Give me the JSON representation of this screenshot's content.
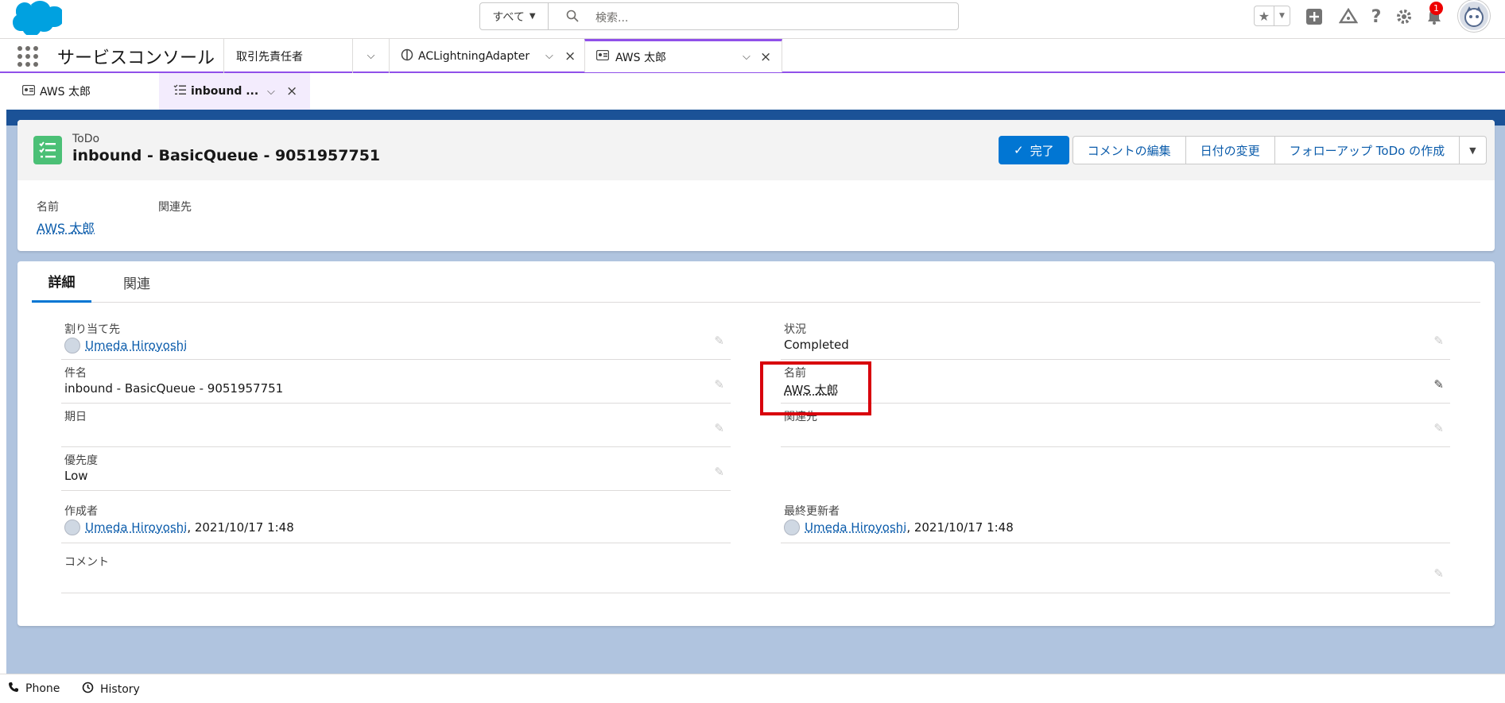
{
  "header": {
    "search_scope": "すべて",
    "search_placeholder": "検索...",
    "notification_count": "1"
  },
  "nav": {
    "app_name": "サービスコンソール",
    "tabs": [
      {
        "label": "取引先責任者"
      },
      {
        "label": "ACLightningAdapter"
      },
      {
        "label": "AWS 太郎"
      }
    ]
  },
  "subtabs": [
    {
      "label": "AWS 太郎"
    },
    {
      "label": "inbound ..."
    }
  ],
  "record": {
    "object_type": "ToDo",
    "title": "inbound - BasicQueue - 9051957751",
    "buttons": {
      "complete": "完了",
      "edit_comment": "コメントの編集",
      "change_date": "日付の変更",
      "create_followup": "フォローアップ ToDo の作成"
    },
    "highlights": {
      "name_label": "名前",
      "name_value": "AWS 太郎",
      "related_label": "関連先"
    }
  },
  "detail": {
    "tabs": {
      "detail": "詳細",
      "related": "関連"
    },
    "fields": {
      "assignee": {
        "label": "割り当て先",
        "value": "Umeda Hiroyoshi"
      },
      "status": {
        "label": "状況",
        "value": "Completed"
      },
      "subject": {
        "label": "件名",
        "value": "inbound - BasicQueue - 9051957751"
      },
      "name": {
        "label": "名前",
        "value": "AWS 太郎"
      },
      "due_date": {
        "label": "期日",
        "value": ""
      },
      "related_to": {
        "label": "関連先",
        "value": ""
      },
      "priority": {
        "label": "優先度",
        "value": "Low"
      },
      "created_by": {
        "label": "作成者",
        "user": "Umeda Hiroyoshi",
        "date": ", 2021/10/17 1:48"
      },
      "modified_by": {
        "label": "最終更新者",
        "user": "Umeda Hiroyoshi",
        "date": ", 2021/10/17 1:48"
      },
      "comment": {
        "label": "コメント",
        "value": ""
      }
    }
  },
  "footer": {
    "phone": "Phone",
    "history": "History"
  },
  "colors": {
    "brand": "#0176d3",
    "link": "#0b5cab",
    "todo_icon": "#4bc076",
    "tab_accent": "#9050e9",
    "highlight_box": "#d8000c",
    "page_bg": "#b0c4df"
  }
}
